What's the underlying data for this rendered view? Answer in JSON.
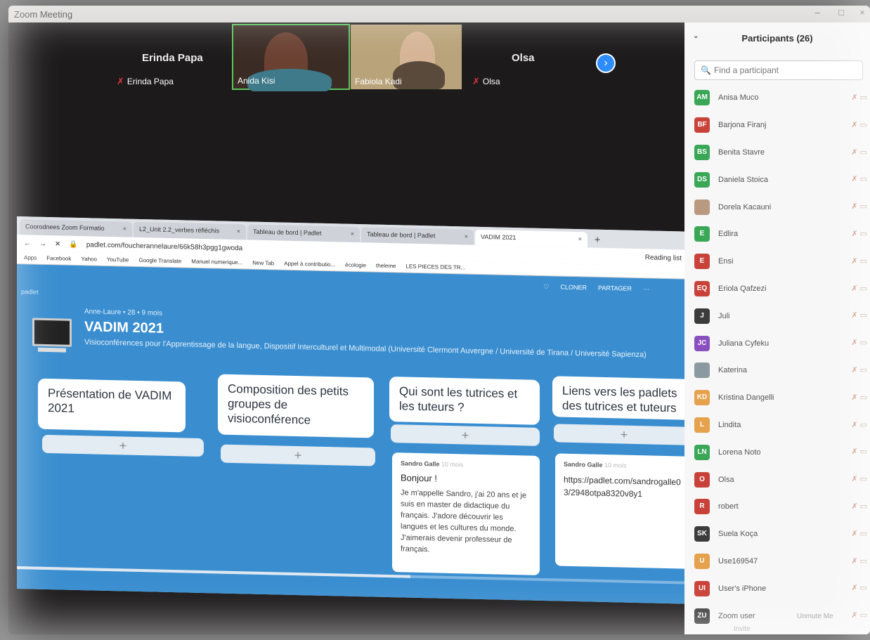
{
  "window": {
    "title": "Zoom Meeting",
    "min": "–",
    "restore": "□",
    "close": "×"
  },
  "gallery": {
    "tiles": [
      {
        "big_name": "Erinda Papa",
        "label": "Erinda Papa",
        "muted": true
      },
      {
        "label": "Anida Kisi",
        "muted": false,
        "active": true
      },
      {
        "label": "Fabiola Kadi",
        "muted": false
      },
      {
        "big_name": "Olsa",
        "label": "Olsa",
        "muted": true
      }
    ],
    "next_icon": "›"
  },
  "browser": {
    "tabs": [
      {
        "label": "Coorodnees Zoom Formatio",
        "close": "×"
      },
      {
        "label": "L2_Unit 2.2_verbes réfléchis",
        "close": "×"
      },
      {
        "label": "Tableau de bord | Padlet",
        "close": "×"
      },
      {
        "label": "Tableau de bord | Padlet",
        "close": "×"
      },
      {
        "label": "VADIM 2021",
        "close": "×"
      }
    ],
    "new_tab": "+",
    "url": "padlet.com/foucherannelaure/66k58h3pgg1gwoda",
    "reading_list": "Reading list",
    "bookmarks": [
      "Apps",
      "Facebook",
      "Yahoo",
      "YouTube",
      "Google Translate",
      "Manuel numerique...",
      "New Tab",
      "Appel à contributio...",
      "écologie",
      "theleme",
      "LES PIECES DES TR..."
    ]
  },
  "padlet": {
    "brand": "padlet",
    "actions": {
      "clone": "CLONER",
      "share": "PARTAGER",
      "more": "···"
    },
    "meta": "Anne-Laure  •  28  •  9 mois",
    "title": "VADIM 2021",
    "description": "Visioconférences pour l'Apprentissage de la langue, Dispositif Interculturel et Multimodal (Université Clermont Auvergne / Université de Tirana / Université Sapienza)",
    "columns": [
      {
        "title": "Présentation de VADIM 2021",
        "add": "+"
      },
      {
        "title": "Composition des petits groupes de visioconférence",
        "add": "+"
      },
      {
        "title": "Qui sont les tutrices et les tuteurs ?",
        "add": "+"
      },
      {
        "title": "Liens vers les padlets des tutrices et tuteurs",
        "add": "+"
      }
    ],
    "post1": {
      "author": "Sandro Galle",
      "age": "10 mois",
      "title": "Bonjour !",
      "body": "Je m'appelle Sandro, j'ai 20 ans et je suis en master de didactique du français. J'adore découvrir les langues et les cultures du monde. J'aimerais devenir professeur de français."
    },
    "post2": {
      "author": "Sandro Galle",
      "age": "10 mois",
      "link": "https://padlet.com/sandrogalle03/2948otpa8320v8y1"
    }
  },
  "participants": {
    "header": "Participants (26)",
    "search_placeholder": "Find a participant",
    "list": [
      {
        "initials": "AM",
        "name": "Anisa Muco",
        "color": "#3aa757"
      },
      {
        "initials": "BF",
        "name": "Barjona Firanj",
        "color": "#c9423a"
      },
      {
        "initials": "BS",
        "name": "Benita Stavre",
        "color": "#3aa757"
      },
      {
        "initials": "DS",
        "name": "Daniela Stoica",
        "color": "#3aa757"
      },
      {
        "initials": "",
        "name": "Dorela Kacauni",
        "color": "#b99980"
      },
      {
        "initials": "E",
        "name": "Edlira",
        "color": "#3aa757"
      },
      {
        "initials": "E",
        "name": "Ensi",
        "color": "#c9423a"
      },
      {
        "initials": "EQ",
        "name": "Eriola Qafzezi",
        "color": "#c9423a"
      },
      {
        "initials": "J",
        "name": "Juli",
        "color": "#3c3c3c"
      },
      {
        "initials": "JC",
        "name": "Juliana Cyfeku",
        "color": "#8a4fbf"
      },
      {
        "initials": "",
        "name": "Katerina",
        "color": "#8a9aa0"
      },
      {
        "initials": "KD",
        "name": "Kristina Dangelli",
        "color": "#e6a14c"
      },
      {
        "initials": "L",
        "name": "Lindita",
        "color": "#e6a14c"
      },
      {
        "initials": "LN",
        "name": "Lorena Noto",
        "color": "#3aa757"
      },
      {
        "initials": "O",
        "name": "Olsa",
        "color": "#c9423a"
      },
      {
        "initials": "R",
        "name": "robert",
        "color": "#c9423a"
      },
      {
        "initials": "SK",
        "name": "Suela Koça",
        "color": "#3c3c3c"
      },
      {
        "initials": "U",
        "name": "Use169547",
        "color": "#e6a14c"
      },
      {
        "initials": "UI",
        "name": "User's iPhone",
        "color": "#c9423a"
      },
      {
        "initials": "ZU",
        "name": "Zoom user",
        "color": "#3c3c3c"
      }
    ],
    "mic_icon": "🎙",
    "unmute": "Unmute Me",
    "invite": "Invite"
  }
}
